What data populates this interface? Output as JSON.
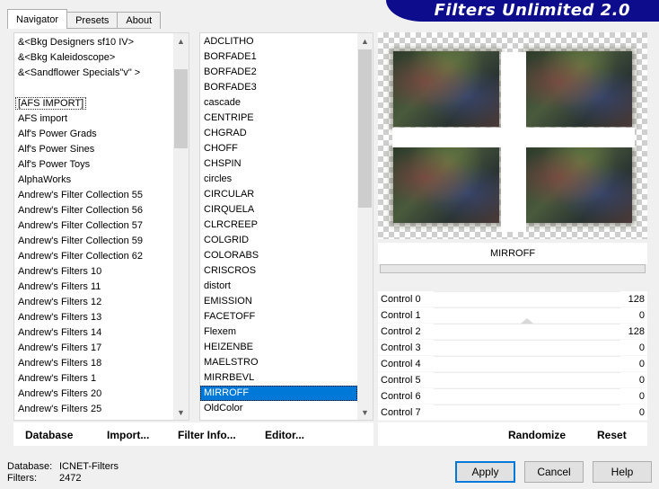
{
  "tabs": [
    {
      "label": "Navigator",
      "active": true
    },
    {
      "label": "Presets",
      "active": false
    },
    {
      "label": "About",
      "active": false
    }
  ],
  "banner": {
    "title": "Filters Unlimited 2.0"
  },
  "categories": {
    "items": [
      "&<Bkg Designers sf10 IV>",
      "&<Bkg Kaleidoscope>",
      "&<Sandflower Specials\"v\" >",
      "",
      "[AFS IMPORT]",
      "AFS import",
      "Alf's Power Grads",
      "Alf's Power Sines",
      "Alf's Power Toys",
      "AlphaWorks",
      "Andrew's Filter Collection 55",
      "Andrew's Filter Collection 56",
      "Andrew's Filter Collection 57",
      "Andrew's Filter Collection 59",
      "Andrew's Filter Collection 62",
      "Andrew's Filters 10",
      "Andrew's Filters 11",
      "Andrew's Filters 12",
      "Andrew's Filters 13",
      "Andrew's Filters 14",
      "Andrew's Filters 17",
      "Andrew's Filters 18",
      "Andrew's Filters 1",
      "Andrew's Filters 20",
      "Andrew's Filters 25"
    ],
    "focused_index": 4
  },
  "filters": {
    "items": [
      "ADCLITHO",
      "BORFADE1",
      "BORFADE2",
      "BORFADE3",
      "cascade",
      "CENTRIPE",
      "CHGRAD",
      "CHOFF",
      "CHSPIN",
      "circles",
      "CIRCULAR",
      "CIRQUELA",
      "CLRCREEP",
      "COLGRID",
      "COLORABS",
      "CRISCROS",
      "distort",
      "EMISSION",
      "FACETOFF",
      "Flexem",
      "HEIZENBE",
      "MAELSTRO",
      "MIRRBEVL",
      "MIRROFF",
      "OldColor"
    ],
    "selected_index": 23
  },
  "preview": {
    "filter_name": "MIRROFF",
    "progress": 0
  },
  "controls": [
    {
      "label": "Control 0",
      "value": "128",
      "level": 0.5
    },
    {
      "label": "Control 1",
      "value": "0",
      "level": 0
    },
    {
      "label": "Control 2",
      "value": "128",
      "level": 0.5
    },
    {
      "label": "Control 3",
      "value": "0",
      "level": 0
    },
    {
      "label": "Control 4",
      "value": "0",
      "level": 0
    },
    {
      "label": "Control 5",
      "value": "0",
      "level": 0
    },
    {
      "label": "Control 6",
      "value": "0",
      "level": 0
    },
    {
      "label": "Control 7",
      "value": "0",
      "level": 0
    }
  ],
  "toolbar": {
    "database_label": "Database",
    "import_label": "Import...",
    "filter_info_label": "Filter Info...",
    "editor_label": "Editor...",
    "randomize_label": "Randomize",
    "reset_label": "Reset"
  },
  "status": {
    "database_label": "Database:",
    "database_value": "ICNET-Filters",
    "filters_label": "Filters:",
    "filters_value": "2472"
  },
  "dialog": {
    "apply_label": "Apply",
    "cancel_label": "Cancel",
    "help_label": "Help"
  }
}
